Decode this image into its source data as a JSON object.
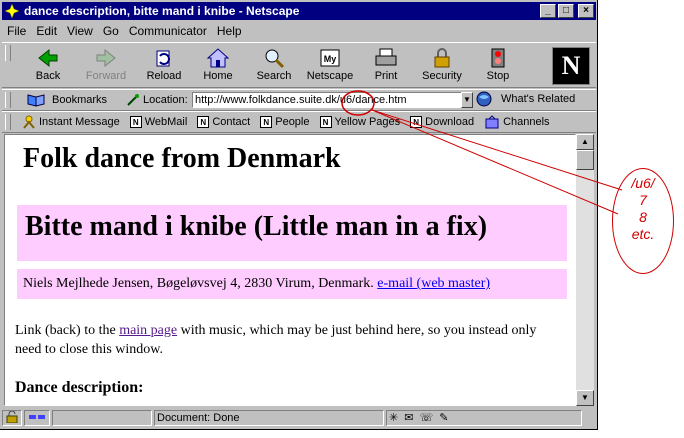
{
  "window": {
    "title": "dance description, bitte mand i knibe - Netscape",
    "minimize_label": "_",
    "maximize_label": "□",
    "close_label": "×"
  },
  "menu": [
    "File",
    "Edit",
    "View",
    "Go",
    "Communicator",
    "Help"
  ],
  "navigation": {
    "buttons": [
      {
        "label": "Back",
        "icon": "back-arrow-icon",
        "enabled": true
      },
      {
        "label": "Forward",
        "icon": "forward-arrow-icon",
        "enabled": false
      },
      {
        "label": "Reload",
        "icon": "reload-icon",
        "enabled": true
      },
      {
        "label": "Home",
        "icon": "home-icon",
        "enabled": true
      },
      {
        "label": "Search",
        "icon": "search-icon",
        "enabled": true
      },
      {
        "label": "Netscape",
        "icon": "netscape-icon",
        "enabled": true
      },
      {
        "label": "Print",
        "icon": "print-icon",
        "enabled": true
      },
      {
        "label": "Security",
        "icon": "security-lock-icon",
        "enabled": true
      },
      {
        "label": "Stop",
        "icon": "stop-icon",
        "enabled": true
      }
    ],
    "logo": "N"
  },
  "location": {
    "bookmarks_label": "Bookmarks",
    "location_label": "Location:",
    "url": "http://www.folkdance.suite.dk/u6/dance.htm",
    "related_label": "What's Related"
  },
  "personal_toolbar": [
    "Instant Message",
    "WebMail",
    "Contact",
    "People",
    "Yellow Pages",
    "Download",
    "Channels"
  ],
  "page": {
    "heading": "Folk dance from Denmark",
    "dance_title": "Bitte mand i knibe (Little man in a fix)",
    "address": "Niels Mejlhede Jensen, Bøgeløvsvej 4, 2830 Virum, Denmark.",
    "email_link": "e-mail (web master)",
    "link_intro": "Link (back) to the",
    "main_page_link": "main page",
    "link_rest": "with music, which may be just behind here, so you instead only need to close this window.",
    "section_heading": "Dance description:"
  },
  "status_bar": {
    "text": "Document: Done"
  },
  "annotation": {
    "lines": [
      "/u6/",
      "7",
      "8",
      "etc."
    ],
    "color": "#d00000"
  },
  "colors": {
    "title_bar": "#000080",
    "pink_box": "#ffccff",
    "link": "#0000ee",
    "visited_link": "#551a8b"
  }
}
